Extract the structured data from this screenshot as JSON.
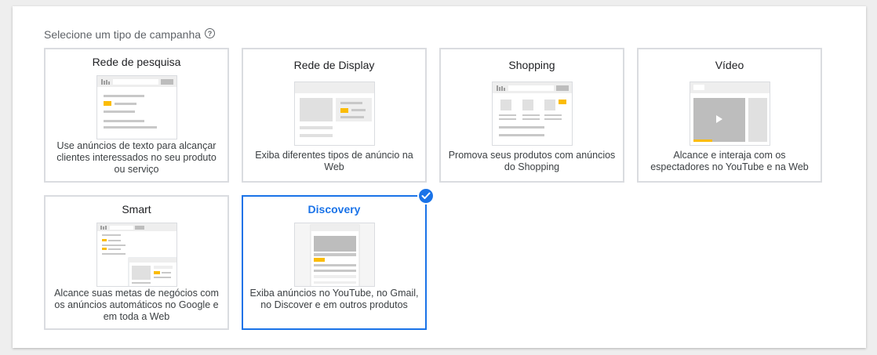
{
  "section": {
    "label": "Selecione um tipo de campanha",
    "help_icon": "help-circle-icon"
  },
  "cards": [
    {
      "title": "Rede de pesquisa",
      "description": "Use anúncios de texto para alcançar clientes interessados no seu produto ou serviço",
      "selected": false
    },
    {
      "title": "Rede de Display",
      "description": "Exiba diferentes tipos de anúncio na Web",
      "selected": false
    },
    {
      "title": "Shopping",
      "description": "Promova seus produtos com anúncios do Shopping",
      "selected": false
    },
    {
      "title": "Vídeo",
      "description": "Alcance e interaja com os espectadores no YouTube e na Web",
      "selected": false
    },
    {
      "title": "Smart",
      "description": "Alcance suas metas de negócios com os anúncios automáticos no Google e em toda a Web",
      "selected": false
    },
    {
      "title": "Discovery",
      "description": "Exiba anúncios no YouTube, no Gmail, no Discover e em outros produtos",
      "selected": true
    }
  ],
  "colors": {
    "accent": "#1a73e8",
    "highlight": "#fbbc04",
    "border": "#dadce0",
    "thumb_gray": "#c8c8c8"
  }
}
